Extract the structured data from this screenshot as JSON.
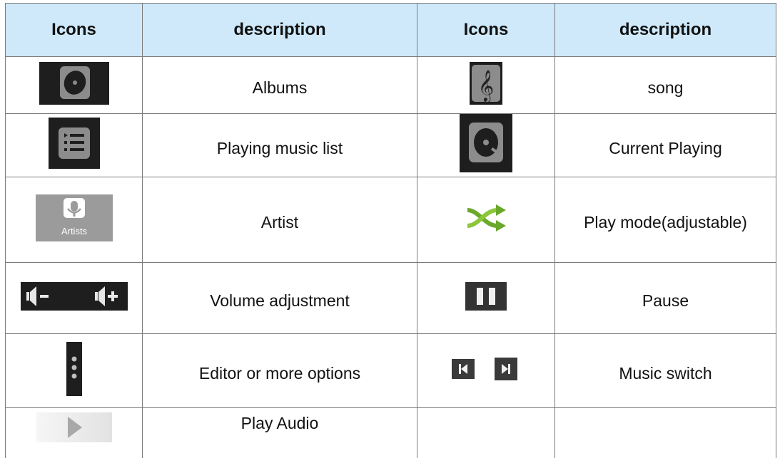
{
  "table": {
    "headers": [
      "Icons",
      "description",
      "Icons",
      "description"
    ],
    "rows": [
      {
        "left_icon": "album-disc-icon",
        "left_desc": "Albums",
        "right_icon": "song-treble-clef-icon",
        "right_desc": "song"
      },
      {
        "left_icon": "playing-list-icon",
        "left_desc": "Playing music list",
        "right_icon": "current-playing-disc-icon",
        "right_desc": "Current Playing"
      },
      {
        "left_icon": "artists-microphone-icon",
        "left_icon_caption": "Artists",
        "left_desc": "Artist",
        "right_icon": "shuffle-icon",
        "right_desc": "Play mode(adjustable)"
      },
      {
        "left_icon": "volume-down-up-icons",
        "left_desc": "Volume adjustment",
        "right_icon": "pause-icon",
        "right_desc": "Pause"
      },
      {
        "left_icon": "more-options-dots-icon",
        "left_desc": "Editor or more options",
        "right_icon": "prev-next-icons",
        "right_desc": "Music switch"
      },
      {
        "left_icon": "play-triangle-icon",
        "left_desc": "Play Audio",
        "right_icon": "",
        "right_desc": ""
      }
    ]
  },
  "colors": {
    "header_bg": "#cfe9fb",
    "icon_dark": "#222222",
    "icon_gray": "#8a8a8a",
    "shuffle_green": "#6aa82a"
  }
}
